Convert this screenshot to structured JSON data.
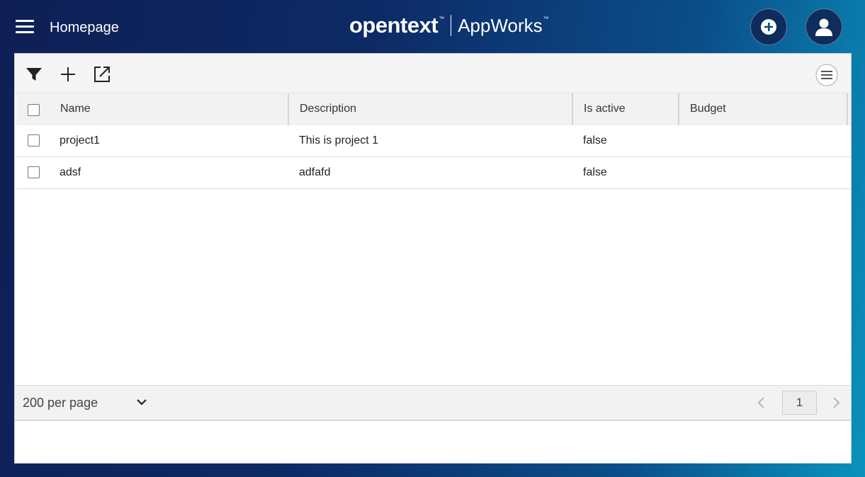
{
  "header": {
    "title": "Homepage",
    "brand_name": "opentext",
    "brand_tm": "™",
    "product_name": "AppWorks",
    "product_tm": "™"
  },
  "toolbar": {
    "icons": [
      "filter-icon",
      "add-icon",
      "open-external-icon",
      "column-menu-icon"
    ]
  },
  "grid": {
    "columns": [
      "Name",
      "Description",
      "Is active",
      "Budget"
    ],
    "rows": [
      {
        "name": "project1",
        "description": "This is project 1",
        "is_active": "false",
        "budget": ""
      },
      {
        "name": "adsf",
        "description": "adfafd",
        "is_active": "false",
        "budget": ""
      }
    ]
  },
  "pagination": {
    "per_page_label": "200 per page",
    "current_page": "1"
  },
  "colors": {
    "header_gradient_start": "#0f1f55",
    "header_gradient_end": "#0a93bd",
    "accent_icon": "#0b6fa0"
  }
}
